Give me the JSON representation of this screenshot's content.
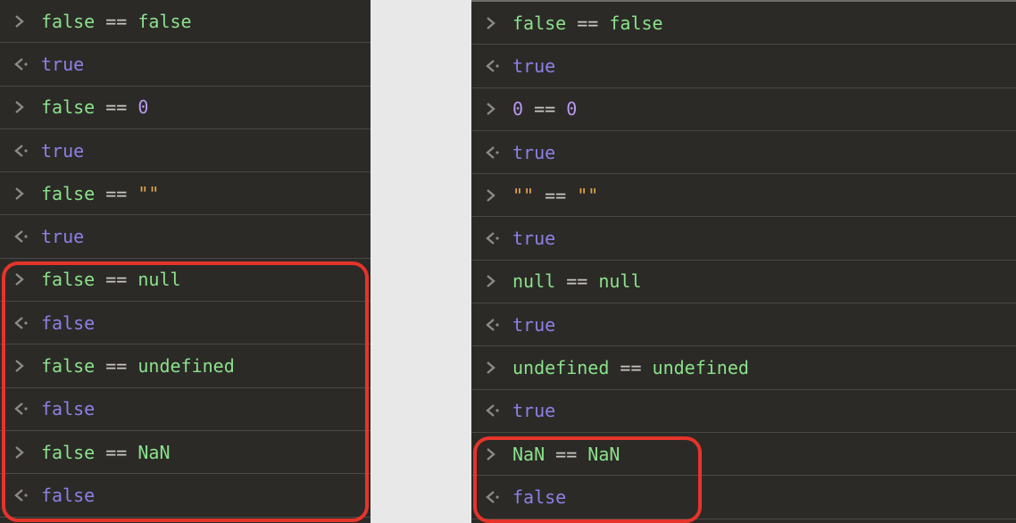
{
  "left": {
    "rows": [
      {
        "kind": "in",
        "tokens": [
          [
            "t-kw",
            "false"
          ],
          [
            "",
            ""
          ],
          [
            "t-op",
            " == "
          ],
          [
            "t-kw",
            "false"
          ]
        ]
      },
      {
        "kind": "out",
        "tokens": [
          [
            "t-bool-out",
            "true"
          ]
        ]
      },
      {
        "kind": "in",
        "tokens": [
          [
            "t-kw",
            "false"
          ],
          [
            "t-op",
            " == "
          ],
          [
            "t-num",
            "0"
          ]
        ]
      },
      {
        "kind": "out",
        "tokens": [
          [
            "t-bool-out",
            "true"
          ]
        ]
      },
      {
        "kind": "in",
        "tokens": [
          [
            "t-kw",
            "false"
          ],
          [
            "t-op",
            " == "
          ],
          [
            "t-str",
            "\"\""
          ]
        ]
      },
      {
        "kind": "out",
        "tokens": [
          [
            "t-bool-out",
            "true"
          ]
        ]
      },
      {
        "kind": "in",
        "tokens": [
          [
            "t-kw",
            "false"
          ],
          [
            "t-op",
            " == "
          ],
          [
            "t-kw",
            "null"
          ]
        ]
      },
      {
        "kind": "out",
        "tokens": [
          [
            "t-bool-out",
            "false"
          ]
        ]
      },
      {
        "kind": "in",
        "tokens": [
          [
            "t-kw",
            "false"
          ],
          [
            "t-op",
            " == "
          ],
          [
            "t-kw",
            "undefined"
          ]
        ]
      },
      {
        "kind": "out",
        "tokens": [
          [
            "t-bool-out",
            "false"
          ]
        ]
      },
      {
        "kind": "in",
        "tokens": [
          [
            "t-kw",
            "false"
          ],
          [
            "t-op",
            " == "
          ],
          [
            "t-kw",
            "NaN"
          ]
        ]
      },
      {
        "kind": "out",
        "tokens": [
          [
            "t-bool-out",
            "false"
          ]
        ]
      }
    ]
  },
  "right": {
    "rows": [
      {
        "kind": "in",
        "tokens": [
          [
            "t-kw",
            "false"
          ],
          [
            "t-op",
            " == "
          ],
          [
            "t-kw",
            "false"
          ]
        ]
      },
      {
        "kind": "out",
        "tokens": [
          [
            "t-bool-out",
            "true"
          ]
        ]
      },
      {
        "kind": "in",
        "tokens": [
          [
            "t-num",
            "0"
          ],
          [
            "t-op",
            " == "
          ],
          [
            "t-num",
            "0"
          ]
        ]
      },
      {
        "kind": "out",
        "tokens": [
          [
            "t-bool-out",
            "true"
          ]
        ]
      },
      {
        "kind": "in",
        "tokens": [
          [
            "t-str",
            "\"\""
          ],
          [
            "t-op",
            " == "
          ],
          [
            "t-str",
            "\"\""
          ]
        ]
      },
      {
        "kind": "out",
        "tokens": [
          [
            "t-bool-out",
            "true"
          ]
        ]
      },
      {
        "kind": "in",
        "tokens": [
          [
            "t-kw",
            "null"
          ],
          [
            "t-op",
            " == "
          ],
          [
            "t-kw",
            "null"
          ]
        ]
      },
      {
        "kind": "out",
        "tokens": [
          [
            "t-bool-out",
            "true"
          ]
        ]
      },
      {
        "kind": "in",
        "tokens": [
          [
            "t-kw",
            "undefined"
          ],
          [
            "t-op",
            " == "
          ],
          [
            "t-kw",
            "undefined"
          ]
        ]
      },
      {
        "kind": "out",
        "tokens": [
          [
            "t-bool-out",
            "true"
          ]
        ]
      },
      {
        "kind": "in",
        "tokens": [
          [
            "t-kw",
            "NaN"
          ],
          [
            "t-op",
            " == "
          ],
          [
            "t-kw",
            "NaN"
          ]
        ]
      },
      {
        "kind": "out",
        "tokens": [
          [
            "t-bool-out",
            "false"
          ]
        ]
      }
    ]
  },
  "icons": {
    "input_chevron": "in",
    "output_chevron": "out"
  }
}
